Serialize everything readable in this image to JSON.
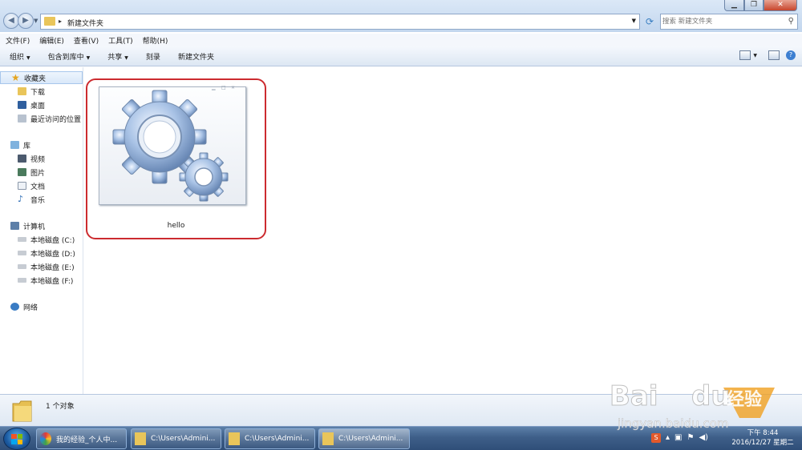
{
  "address": {
    "path": "新建文件夹"
  },
  "search": {
    "placeholder": "搜索 新建文件夹"
  },
  "menu": [
    "文件(F)",
    "编辑(E)",
    "查看(V)",
    "工具(T)",
    "帮助(H)"
  ],
  "toolbar": {
    "organize": "组织",
    "include": "包含到库中",
    "share": "共享",
    "burn": "刻录",
    "new_folder": "新建文件夹"
  },
  "sidebar": {
    "favorites": "收藏夹",
    "downloads": "下载",
    "desktop": "桌面",
    "recent": "最近访问的位置",
    "libraries": "库",
    "videos": "视频",
    "pictures": "图片",
    "documents": "文档",
    "music": "音乐",
    "computer": "计算机",
    "disk_c": "本地磁盘 (C:)",
    "disk_d": "本地磁盘 (D:)",
    "disk_e": "本地磁盘 (E:)",
    "disk_f": "本地磁盘 (F:)",
    "network": "网络"
  },
  "file": {
    "name": "hello"
  },
  "status": {
    "count": "1 个对象"
  },
  "taskbar": {
    "items": [
      "我的经验_个人中...",
      "C:\\Users\\Admini...",
      "C:\\Users\\Admini...",
      "C:\\Users\\Admini..."
    ],
    "time": "下午 8:44",
    "date": "2016/12/27 星期二"
  },
  "watermark": {
    "line1": "Baidu",
    "line2": "经验",
    "line3": "jingyan.baidu.com"
  },
  "colors": {
    "highlight_border": "#cc2b2f",
    "folder": "#e9c55a",
    "taskbar": "#3e5f89"
  }
}
